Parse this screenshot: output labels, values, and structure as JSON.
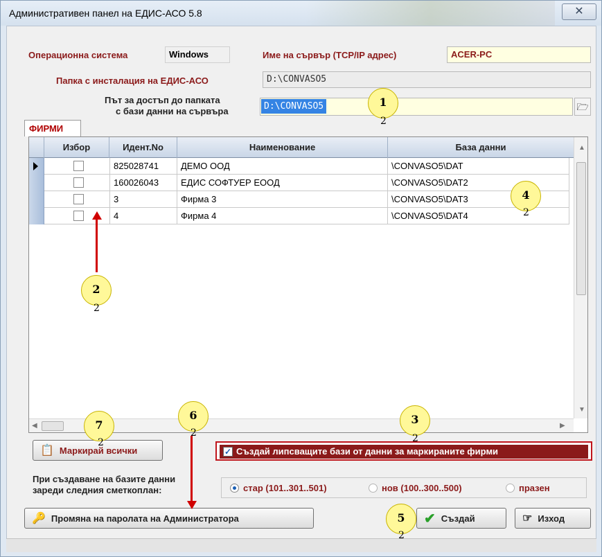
{
  "window": {
    "title": "Административен панел на ЕДИС-АСО 5.8",
    "close_glyph": "✕"
  },
  "os": {
    "label": "Операционна система",
    "value": "Windows"
  },
  "server": {
    "label": "Име на сървър (TCP/IP адрес)",
    "value": "ACER-PC"
  },
  "install": {
    "label": "Папка с инсталация на ЕДИС-АСО",
    "value": "D:\\CONVASO5"
  },
  "db_path": {
    "label_line1": "Път за достъп до папката",
    "label_line2": "с бази данни на сървъра",
    "value": "D:\\CONVASO5",
    "browse_icon": "folder-open-icon"
  },
  "tab": {
    "label": "ФИРМИ"
  },
  "grid": {
    "columns": [
      "Избор",
      "Идент.No",
      "Наименование",
      "База данни"
    ],
    "rows": [
      {
        "id": "825028741",
        "name": "ДЕМО ООД",
        "db": "\\CONVASO5\\DAT",
        "selected_row": true
      },
      {
        "id": "160026043",
        "name": "ЕДИС СОФТУЕР ЕООД",
        "db": "\\CONVASO5\\DAT2",
        "selected_row": false
      },
      {
        "id": "3",
        "name": "Фирма 3",
        "db": "\\CONVASO5\\DAT3",
        "selected_row": false
      },
      {
        "id": "4",
        "name": "Фирма 4",
        "db": "\\CONVASO5\\DAT4",
        "selected_row": false
      }
    ]
  },
  "buttons": {
    "mark_all": "Маркирай всички",
    "change_password": "Промяна на паролата на Администратора",
    "create": "Създай",
    "exit": "Изход"
  },
  "create_missing": {
    "label": "Създай липсващите бази от данни за маркираните фирми",
    "checked": true
  },
  "chart_of_accounts": {
    "label_line1": "При създаване на базите данни",
    "label_line2": "зареди следния сметкоплан:",
    "options": [
      "стар (101..301..501)",
      "нов (100..300..500)",
      "празен"
    ],
    "selected": "стар (101..301..501)"
  },
  "annotations": {
    "badges": [
      "1",
      "2",
      "3",
      "4",
      "5",
      "6",
      "7"
    ],
    "sub": "2"
  },
  "colors": {
    "accent_red": "#8b1a1a",
    "annotation_red": "#d00000",
    "badge_fill": "#fff899"
  }
}
